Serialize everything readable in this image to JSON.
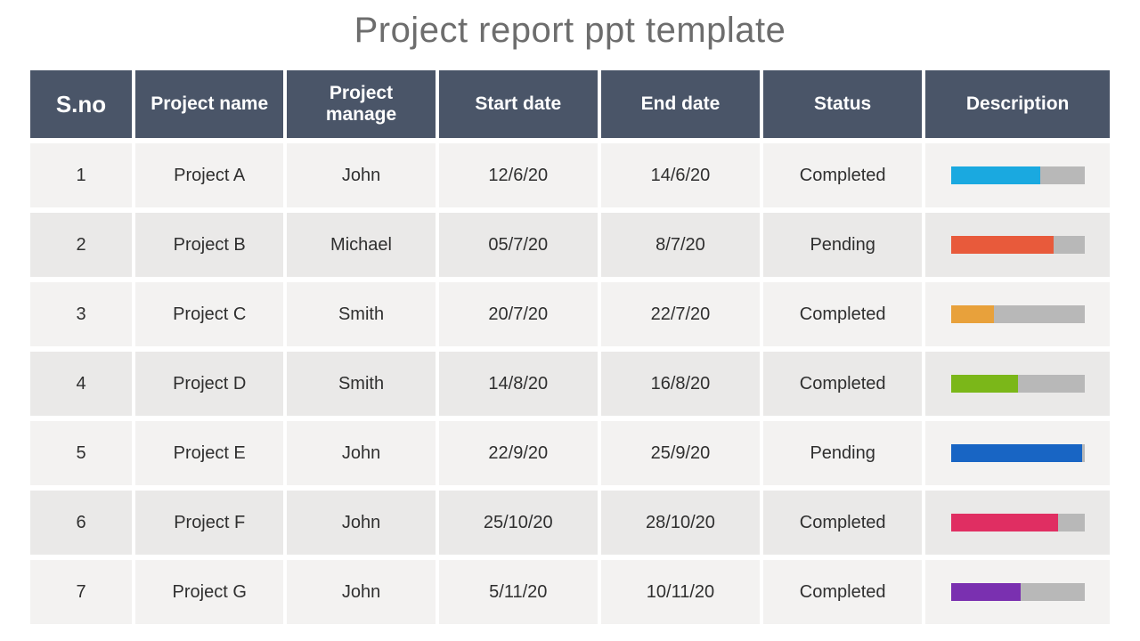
{
  "title": "Project report ppt template",
  "headers": {
    "sno": "S.no",
    "name": "Project name",
    "manager": "Project manage",
    "start": "Start date",
    "end": "End date",
    "status": "Status",
    "desc": "Description"
  },
  "rows": [
    {
      "sno": "1",
      "name": "Project A",
      "manager": "John",
      "start": "12/6/20",
      "end": "14/6/20",
      "status": "Completed",
      "bar_pct": 67,
      "bar_color": "#1aa9e0"
    },
    {
      "sno": "2",
      "name": "Project B",
      "manager": "Michael",
      "start": "05/7/20",
      "end": "8/7/20",
      "status": "Pending",
      "bar_pct": 77,
      "bar_color": "#e85a3b"
    },
    {
      "sno": "3",
      "name": "Project C",
      "manager": "Smith",
      "start": "20/7/20",
      "end": "22/7/20",
      "status": "Completed",
      "bar_pct": 32,
      "bar_color": "#e8a13b"
    },
    {
      "sno": "4",
      "name": "Project D",
      "manager": "Smith",
      "start": "14/8/20",
      "end": "16/8/20",
      "status": "Completed",
      "bar_pct": 50,
      "bar_color": "#7bb719"
    },
    {
      "sno": "5",
      "name": "Project E",
      "manager": "John",
      "start": "22/9/20",
      "end": "25/9/20",
      "status": "Pending",
      "bar_pct": 98,
      "bar_color": "#1865c4"
    },
    {
      "sno": "6",
      "name": "Project F",
      "manager": "John",
      "start": "25/10/20",
      "end": "28/10/20",
      "status": "Completed",
      "bar_pct": 80,
      "bar_color": "#e02e62"
    },
    {
      "sno": "7",
      "name": "Project G",
      "manager": "John",
      "start": "5/11/20",
      "end": "10/11/20",
      "status": "Completed",
      "bar_pct": 52,
      "bar_color": "#7a30b0"
    }
  ],
  "chart_data": {
    "type": "bar",
    "title": "Description progress bars",
    "categories": [
      "Project A",
      "Project B",
      "Project C",
      "Project D",
      "Project E",
      "Project F",
      "Project G"
    ],
    "values": [
      67,
      77,
      32,
      50,
      98,
      80,
      52
    ],
    "ylim": [
      0,
      100
    ],
    "xlabel": "",
    "ylabel": ""
  }
}
